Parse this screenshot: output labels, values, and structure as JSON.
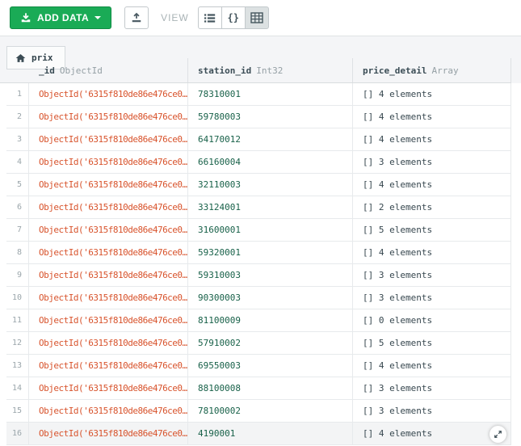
{
  "toolbar": {
    "add_data_label": "ADD DATA",
    "view_label": "VIEW",
    "json_view_label": "{}"
  },
  "tab": {
    "label": "prix"
  },
  "table": {
    "columns": [
      {
        "name": "_id",
        "type": "ObjectId"
      },
      {
        "name": "station_id",
        "type": "Int32"
      },
      {
        "name": "price_detail",
        "type": "Array"
      }
    ],
    "rows": [
      {
        "num": 1,
        "id": "ObjectId('6315f810de86e476ce0…",
        "station_id": "78310001",
        "price_detail": "[] 4 elements"
      },
      {
        "num": 2,
        "id": "ObjectId('6315f810de86e476ce0…",
        "station_id": "59780003",
        "price_detail": "[] 4 elements"
      },
      {
        "num": 3,
        "id": "ObjectId('6315f810de86e476ce0…",
        "station_id": "64170012",
        "price_detail": "[] 4 elements"
      },
      {
        "num": 4,
        "id": "ObjectId('6315f810de86e476ce0…",
        "station_id": "66160004",
        "price_detail": "[] 3 elements"
      },
      {
        "num": 5,
        "id": "ObjectId('6315f810de86e476ce0…",
        "station_id": "32110003",
        "price_detail": "[] 4 elements"
      },
      {
        "num": 6,
        "id": "ObjectId('6315f810de86e476ce0…",
        "station_id": "33124001",
        "price_detail": "[] 2 elements"
      },
      {
        "num": 7,
        "id": "ObjectId('6315f810de86e476ce0…",
        "station_id": "31600001",
        "price_detail": "[] 5 elements"
      },
      {
        "num": 8,
        "id": "ObjectId('6315f810de86e476ce0…",
        "station_id": "59320001",
        "price_detail": "[] 4 elements"
      },
      {
        "num": 9,
        "id": "ObjectId('6315f810de86e476ce0…",
        "station_id": "59310003",
        "price_detail": "[] 3 elements"
      },
      {
        "num": 10,
        "id": "ObjectId('6315f810de86e476ce0…",
        "station_id": "90300003",
        "price_detail": "[] 3 elements"
      },
      {
        "num": 11,
        "id": "ObjectId('6315f810de86e476ce0…",
        "station_id": "81100009",
        "price_detail": "[] 0 elements"
      },
      {
        "num": 12,
        "id": "ObjectId('6315f810de86e476ce0…",
        "station_id": "57910002",
        "price_detail": "[] 5 elements"
      },
      {
        "num": 13,
        "id": "ObjectId('6315f810de86e476ce0…",
        "station_id": "69550003",
        "price_detail": "[] 4 elements"
      },
      {
        "num": 14,
        "id": "ObjectId('6315f810de86e476ce0…",
        "station_id": "88100008",
        "price_detail": "[] 3 elements"
      },
      {
        "num": 15,
        "id": "ObjectId('6315f810de86e476ce0…",
        "station_id": "78100002",
        "price_detail": "[] 3 elements"
      },
      {
        "num": 16,
        "id": "ObjectId('6315f810de86e476ce0…",
        "station_id": "4190001",
        "price_detail": "[] 4 elements",
        "hovered": true,
        "has_expand": true
      }
    ]
  },
  "icons": {
    "add_data": "download-icon",
    "export": "upload-icon",
    "list_view": "list-icon",
    "json_view": "braces-glyph",
    "table_view": "table-grid-icon",
    "tab": "home-icon",
    "row_expand": "expand-diagonal-icon"
  },
  "colors": {
    "accent_green": "#1aab56",
    "objectid_text": "#d8532c",
    "int32_text": "#186149",
    "band_background": "#f4f5f7",
    "selected_segment": "#dce1e2"
  }
}
